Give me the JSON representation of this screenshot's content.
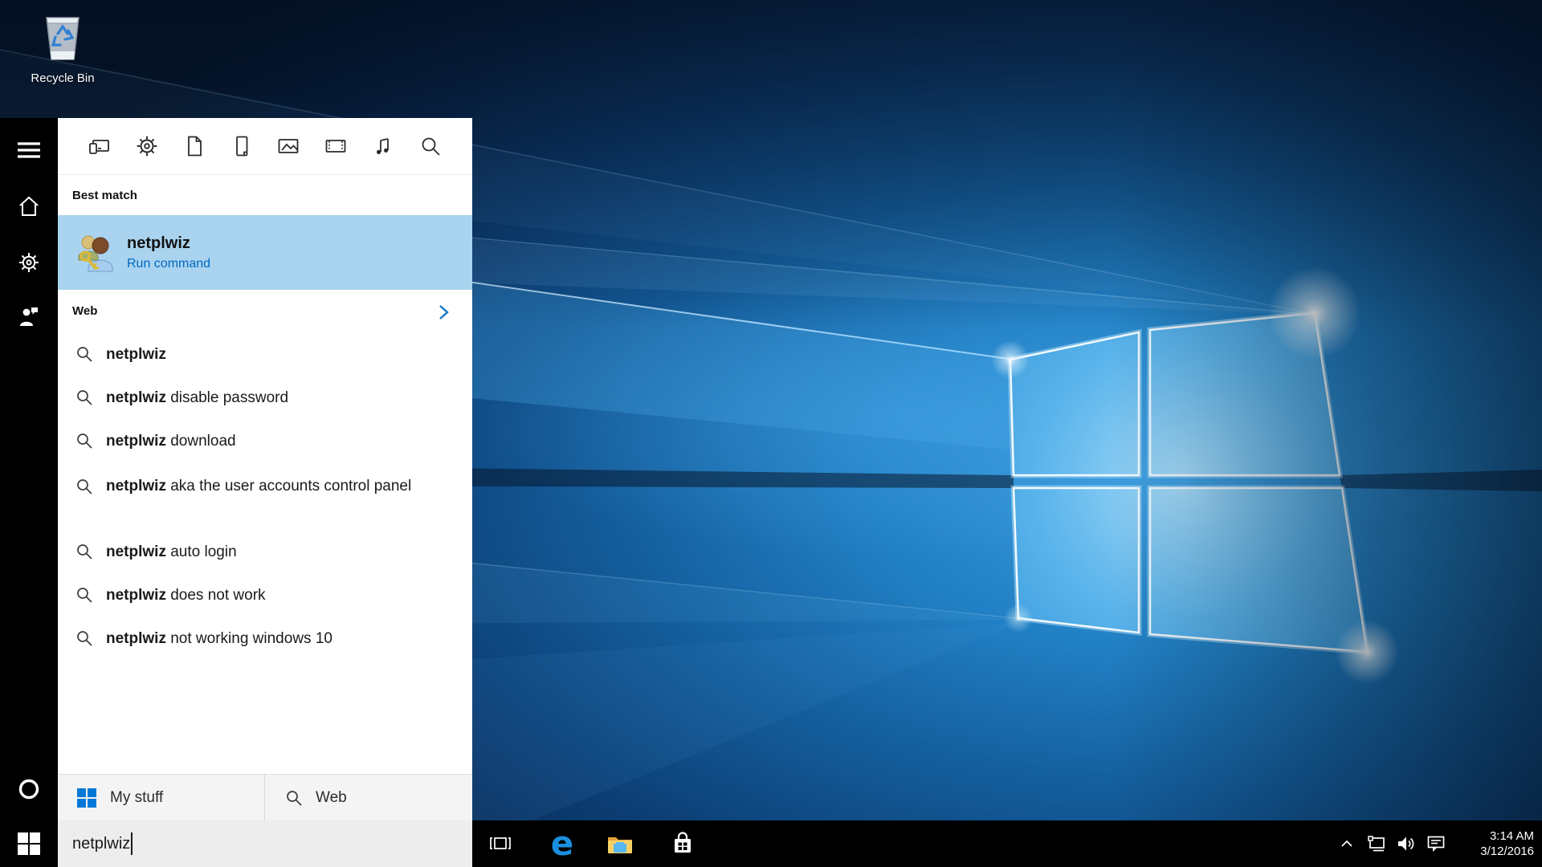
{
  "desktop": {
    "recycle_bin_label": "Recycle Bin"
  },
  "sidebar": {
    "items": [
      "menu",
      "home",
      "settings",
      "feedback",
      "cortana"
    ]
  },
  "search_panel": {
    "filters": [
      "apps",
      "settings",
      "documents",
      "phone",
      "photos",
      "videos",
      "music",
      "web-search"
    ],
    "best_match": {
      "header": "Best match",
      "result_title": "netplwiz",
      "result_subtitle": "Run command"
    },
    "web": {
      "header": "Web",
      "suggestions": [
        {
          "bold": "netplwiz",
          "rest": ""
        },
        {
          "bold": "netplwiz",
          "rest": " disable password"
        },
        {
          "bold": "netplwiz",
          "rest": " download"
        },
        {
          "bold": "netplwiz",
          "rest": " aka the user accounts control panel"
        },
        {
          "bold": "netplwiz",
          "rest": " auto login"
        },
        {
          "bold": "netplwiz",
          "rest": " does not work"
        },
        {
          "bold": "netplwiz",
          "rest": " not working windows 10"
        }
      ]
    },
    "footer": {
      "my_stuff_label": "My stuff",
      "web_label": "Web"
    }
  },
  "taskbar": {
    "search_value": "netplwiz",
    "clock": {
      "time": "3:14 AM",
      "date": "3/12/2016"
    }
  },
  "colors": {
    "accent": "#0078d7",
    "best_match_highlight": "#a9d3ef",
    "run_command_text": "#0069bf",
    "taskbar": "#000000",
    "taskbar_search_bg": "#ededed"
  }
}
